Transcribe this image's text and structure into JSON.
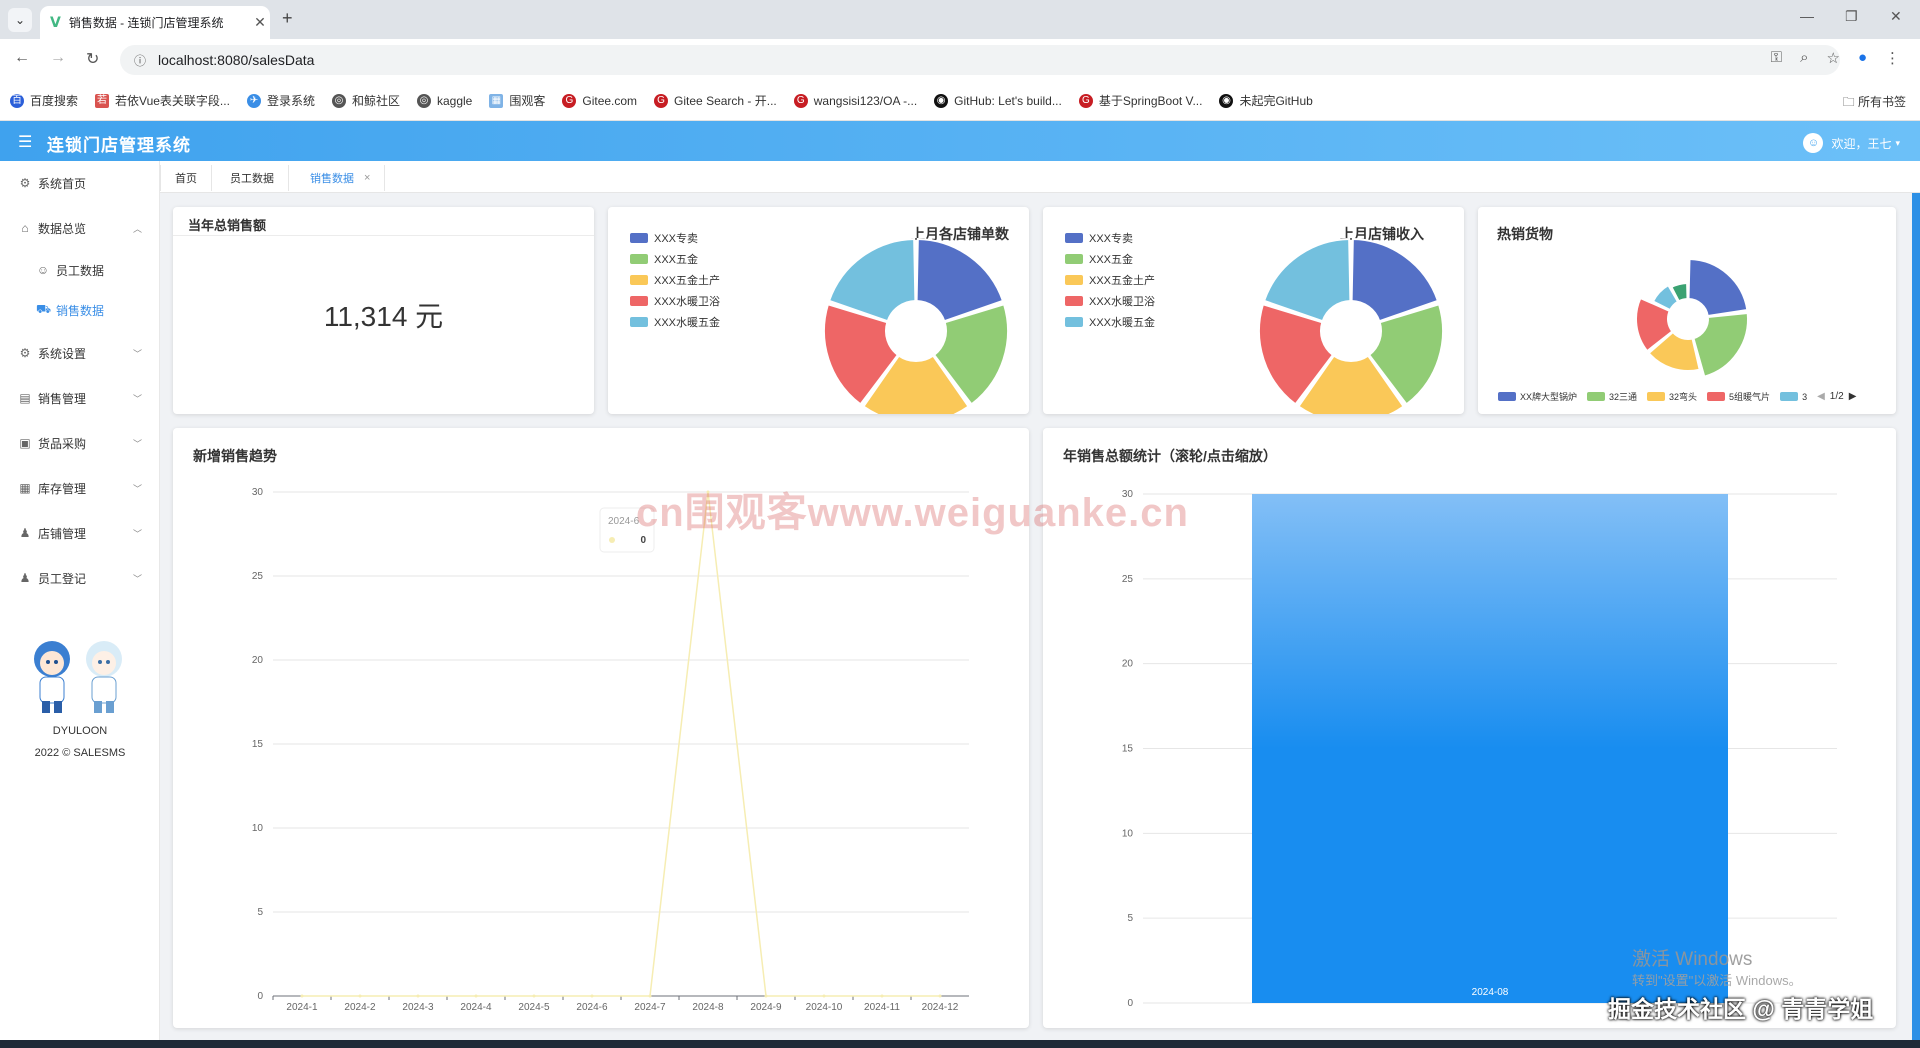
{
  "browser": {
    "tab_title": "销售数据 - 连锁门店管理系统",
    "url": "localhost:8080/salesData",
    "bookmarks": [
      "百度搜索",
      "若依Vue表关联字段...",
      "登录系统",
      "和鲸社区",
      "kaggle",
      "围观客",
      "Gitee.com",
      "Gitee Search - 开...",
      "wangsisi123/OA -...",
      "GitHub: Let's build...",
      "基于SpringBoot V...",
      "未起完GitHub"
    ],
    "bookmarks_all": "所有书签"
  },
  "app": {
    "title": "连锁门店管理系统",
    "welcome": "欢迎，王七"
  },
  "sidebar": {
    "home": "系统首页",
    "overview": "数据总览",
    "staff_data": "员工数据",
    "sales_data": "销售数据",
    "settings": "系统设置",
    "sales_mgmt": "销售管理",
    "purchase": "货品采购",
    "inventory": "库存管理",
    "store_mgmt": "店铺管理",
    "staff_register": "员工登记",
    "footer_name": "DYULOON",
    "footer_copy": "2022 © SALESMS"
  },
  "tags": {
    "home": "首页",
    "staff": "员工数据",
    "sales": "销售数据",
    "close": "×"
  },
  "cards": {
    "total": {
      "title": "当年总销售额",
      "value": "11,314 元"
    },
    "orders": {
      "title": "上月各店铺单数"
    },
    "income": {
      "title": "上月店铺收入"
    },
    "hot": {
      "title": "热销货物",
      "pager": "1/2"
    },
    "trend": {
      "title": "新增销售趋势"
    },
    "annual": {
      "title": "年销售总额统计（滚轮/点击缩放）"
    }
  },
  "colors": {
    "blue": "#5470c6",
    "green": "#91cc75",
    "yellow": "#fac858",
    "red": "#ee6666",
    "cyan": "#73c0de",
    "teal": "#3ba272",
    "accent": "#3a8ee6"
  },
  "chart_data": [
    {
      "type": "pie",
      "title": "上月各店铺单数",
      "categories": [
        "XXX专卖",
        "XXX五金",
        "XXX五金土产",
        "XXX水暖卫浴",
        "XXX水暖五金"
      ],
      "values": [
        20,
        20,
        20,
        20,
        20
      ]
    },
    {
      "type": "pie",
      "title": "上月店铺收入",
      "categories": [
        "XXX专卖",
        "XXX五金",
        "XXX五金土产",
        "XXX水暖卫浴",
        "XXX水暖五金"
      ],
      "values": [
        20,
        20,
        20,
        20,
        20
      ]
    },
    {
      "type": "pie",
      "title": "热销货物",
      "categories": [
        "XX牌大型锅炉",
        "32三通",
        "32弯头",
        "5组暖气片",
        "3",
        "?"
      ],
      "legend_visible": [
        "XX牌大型锅炉",
        "32三通",
        "32弯头",
        "5组暖气片",
        "3"
      ],
      "values": [
        23,
        23,
        18,
        18,
        10,
        8
      ]
    },
    {
      "type": "line",
      "title": "新增销售趋势",
      "categories": [
        "2024-1",
        "2024-2",
        "2024-3",
        "2024-4",
        "2024-5",
        "2024-6",
        "2024-7",
        "2024-8",
        "2024-9",
        "2024-10",
        "2024-11",
        "2024-12"
      ],
      "values": [
        0,
        0,
        0,
        0,
        0,
        0,
        0,
        30,
        0,
        0,
        0,
        0
      ],
      "ylim": [
        0,
        30
      ],
      "yticks": [
        0,
        5,
        10,
        15,
        20,
        25,
        30
      ],
      "tooltip": {
        "label": "2024-6",
        "value": "0"
      }
    },
    {
      "type": "bar",
      "title": "年销售总额统计（滚轮/点击缩放）",
      "categories": [
        "2024-08"
      ],
      "values": [
        30
      ],
      "ylim": [
        0,
        30
      ],
      "yticks": [
        0,
        5,
        10,
        15,
        20,
        25,
        30
      ]
    }
  ],
  "overlays": {
    "watermark": "cn围观客www.weiguanke.cn",
    "win_activate": "激活 Windows",
    "win_activate_sub": "转到\"设置\"以激活 Windows。",
    "juejin": "掘金技术社区 @ 青青学姐"
  }
}
